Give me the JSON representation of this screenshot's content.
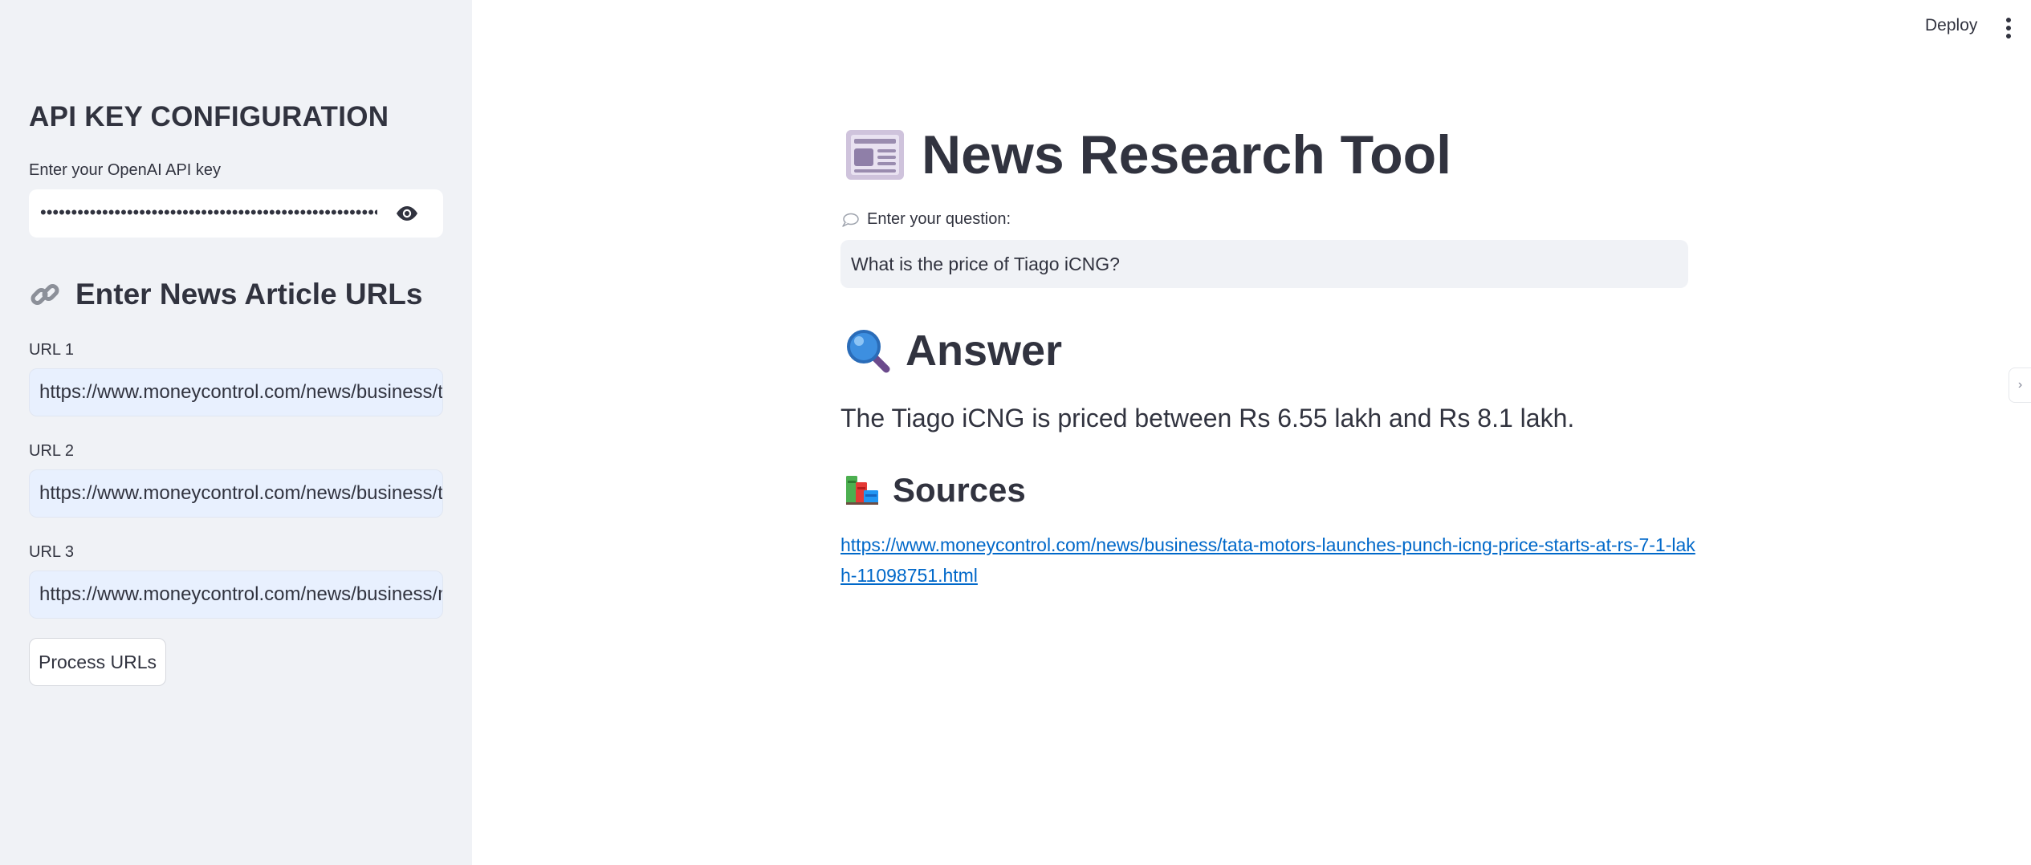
{
  "sidebar": {
    "api_heading": "API KEY CONFIGURATION",
    "api_label": "Enter your OpenAI API key",
    "api_value_masked": "••••••••••••••••••••••••••••••••••••••••••••••••••••••••",
    "urls_heading": "Enter News Article URLs",
    "urls": [
      {
        "label": "URL 1",
        "value": "https://www.moneycontrol.com/news/business/tata-motors-launches-punch-icng-price-starts-at-rs-7-1-lakh-11098751.html"
      },
      {
        "label": "URL 2",
        "value": "https://www.moneycontrol.com/news/business/tata-motors-mahindra-gain-certificates-for-production-linked-payouts-11281691.html"
      },
      {
        "label": "URL 3",
        "value": "https://www.moneycontrol.com/news/business/markets/buy-tata-motors-target-of-rs-743-kr-choksey-11080811.html"
      }
    ],
    "process_button": "Process URLs"
  },
  "header": {
    "deploy_label": "Deploy"
  },
  "main": {
    "title": "News Research Tool",
    "question_label": "Enter your question:",
    "question_value": "What is the price of Tiago iCNG?",
    "answer_heading": "Answer",
    "answer_text": "The Tiago iCNG is priced between Rs 6.55 lakh and Rs 8.1 lakh.",
    "sources_heading": "Sources",
    "source_link": "https://www.moneycontrol.com/news/business/tata-motors-launches-punch-icng-price-starts-at-rs-7-1-lakh-11098751.html"
  },
  "icons": {
    "title": "newspaper-icon",
    "question": "speech-bubble-icon",
    "answer": "magnifier-icon",
    "sources": "books-icon",
    "urls_heading": "link-icon",
    "password_toggle": "eye-icon",
    "menu": "kebab-menu-icon"
  },
  "colors": {
    "sidebar_bg": "#f0f2f6",
    "text": "#31333f",
    "link": "#0068c9",
    "url_input_bg": "#e8f0fe"
  }
}
